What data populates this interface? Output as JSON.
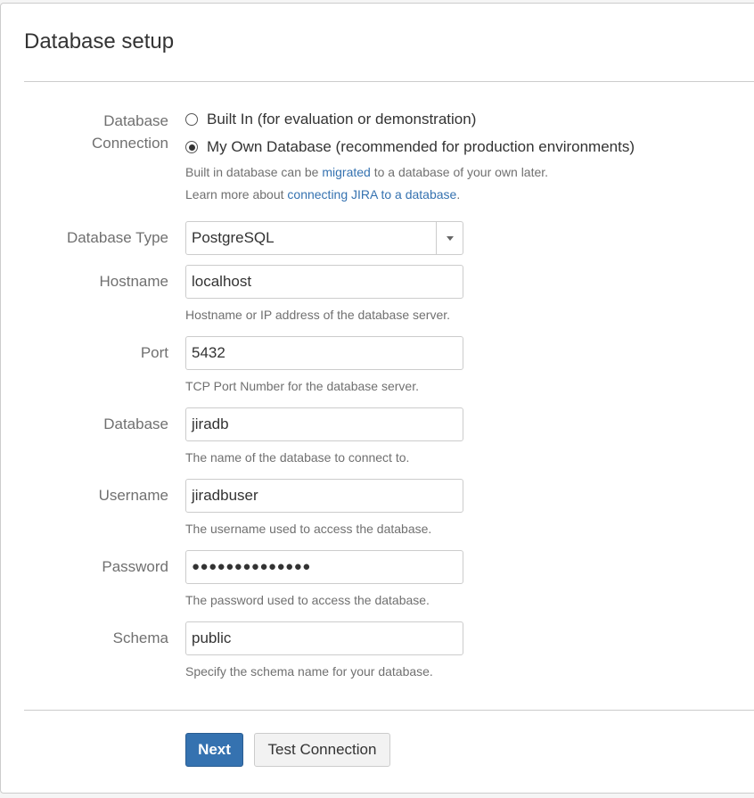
{
  "page": {
    "title": "Database setup"
  },
  "connection": {
    "label_line1": "Database",
    "label_line2": "Connection",
    "options": [
      {
        "label": "Built In (for evaluation or demonstration)",
        "checked": false
      },
      {
        "label": "My Own Database (recommended for production environments)",
        "checked": true
      }
    ],
    "help1_pre": "Built in database can be ",
    "help1_link": "migrated",
    "help1_post": " to a database of your own later.",
    "help2_pre": "Learn more about ",
    "help2_link": "connecting JIRA to a database",
    "help2_post": "."
  },
  "fields": {
    "db_type": {
      "label": "Database Type",
      "value": "PostgreSQL"
    },
    "hostname": {
      "label": "Hostname",
      "value": "localhost",
      "help": "Hostname or IP address of the database server."
    },
    "port": {
      "label": "Port",
      "value": "5432",
      "help": "TCP Port Number for the database server."
    },
    "database": {
      "label": "Database",
      "value": "jiradb",
      "help": "The name of the database to connect to."
    },
    "username": {
      "label": "Username",
      "value": "jiradbuser",
      "help": "The username used to access the database."
    },
    "password": {
      "label": "Password",
      "value": "●●●●●●●●●●●●●●",
      "help": "The password used to access the database."
    },
    "schema": {
      "label": "Schema",
      "value": "public",
      "help": "Specify the schema name for your database."
    }
  },
  "actions": {
    "next": "Next",
    "test": "Test Connection"
  },
  "colors": {
    "accent": "#3572b0",
    "label": "#707070",
    "border": "#cccccc"
  }
}
